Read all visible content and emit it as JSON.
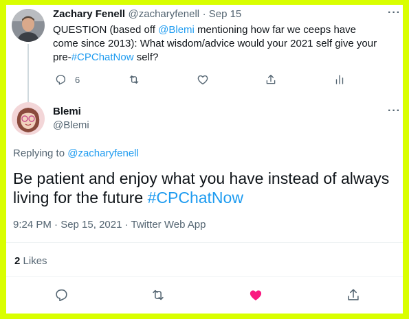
{
  "first_tweet": {
    "author_name": "Zachary Fenell",
    "author_handle": "@zacharyfenell",
    "date": "· Sep 15",
    "text_1": "QUESTION (based off ",
    "mention": "@Blemi",
    "text_2": " mentioning how far we ceeps have come since 2013): What wisdom/advice would your 2021 self give your pre-",
    "hashtag": "#CPChatNow",
    "text_3": " self?",
    "reply_count": "6",
    "more_label": "···"
  },
  "main_tweet": {
    "author_name": "Blemi",
    "author_handle": "@Blemi",
    "more_label": "···",
    "replying_label": "Replying to ",
    "replying_to": "@zacharyfenell",
    "text": "Be patient and enjoy what you have instead of always living for the future ",
    "hashtag": "#CPChatNow",
    "timestamp": "9:24 PM · Sep 15, 2021 · Twitter Web App",
    "likes_count": "2",
    "likes_label": "Likes"
  },
  "icons": {
    "reply": "reply-icon",
    "retweet": "retweet-icon",
    "like": "heart-icon",
    "share": "share-icon",
    "analytics": "analytics-icon"
  },
  "colors": {
    "background_border": "#d9ff00",
    "link": "#1d9bf0",
    "liked": "#f91880",
    "secondary_text": "#536471"
  }
}
